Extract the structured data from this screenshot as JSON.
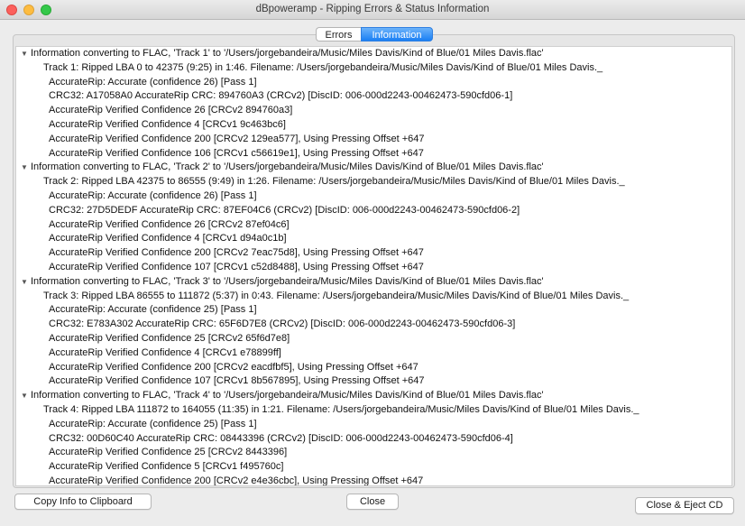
{
  "window": {
    "title": "dBpoweramp - Ripping Errors & Status Information"
  },
  "tabs": [
    {
      "label": "Errors",
      "selected": false
    },
    {
      "label": "Information",
      "selected": true
    }
  ],
  "log": [
    {
      "level": 0,
      "text": "Information converting to FLAC, 'Track 1' to '/Users/jorgebandeira/Music/Miles Davis/Kind of Blue/01 Miles Davis.flac'"
    },
    {
      "level": 1,
      "text": "Track 1:  Ripped LBA 0 to 42375 (9:25) in 1:46. Filename: /Users/jorgebandeira/Music/Miles Davis/Kind of Blue/01 Miles Davis._"
    },
    {
      "level": 2,
      "text": "AccurateRip: Accurate (confidence 26)     [Pass 1]"
    },
    {
      "level": 2,
      "text": "CRC32: A17058A0     AccurateRip CRC: 894760A3 (CRCv2)      [DiscID: 006-000d2243-00462473-590cfd06-1]"
    },
    {
      "level": 2,
      "text": "AccurateRip Verified Confidence 26 [CRCv2 894760a3]"
    },
    {
      "level": 2,
      "text": "AccurateRip Verified Confidence 4 [CRCv1 9c463bc6]"
    },
    {
      "level": 2,
      "text": "AccurateRip Verified Confidence 200 [CRCv2 129ea577], Using Pressing Offset +647"
    },
    {
      "level": 2,
      "text": "AccurateRip Verified Confidence 106 [CRCv1 c56619e1], Using Pressing Offset +647"
    },
    {
      "level": 0,
      "text": "Information converting to FLAC, 'Track 2' to '/Users/jorgebandeira/Music/Miles Davis/Kind of Blue/01 Miles Davis.flac'"
    },
    {
      "level": 1,
      "text": "Track 2:  Ripped LBA 42375 to 86555 (9:49) in 1:26. Filename: /Users/jorgebandeira/Music/Miles Davis/Kind of Blue/01 Miles Davis._"
    },
    {
      "level": 2,
      "text": "AccurateRip: Accurate (confidence 26)     [Pass 1]"
    },
    {
      "level": 2,
      "text": "CRC32: 27D5DEDF     AccurateRip CRC: 87EF04C6 (CRCv2)      [DiscID: 006-000d2243-00462473-590cfd06-2]"
    },
    {
      "level": 2,
      "text": "AccurateRip Verified Confidence 26 [CRCv2 87ef04c6]"
    },
    {
      "level": 2,
      "text": "AccurateRip Verified Confidence 4 [CRCv1 d94a0c1b]"
    },
    {
      "level": 2,
      "text": "AccurateRip Verified Confidence 200 [CRCv2 7eac75d8], Using Pressing Offset +647"
    },
    {
      "level": 2,
      "text": "AccurateRip Verified Confidence 107 [CRCv1 c52d8488], Using Pressing Offset +647"
    },
    {
      "level": 0,
      "text": "Information converting to FLAC, 'Track 3' to '/Users/jorgebandeira/Music/Miles Davis/Kind of Blue/01 Miles Davis.flac'"
    },
    {
      "level": 1,
      "text": "Track 3:  Ripped LBA 86555 to 111872 (5:37) in 0:43. Filename: /Users/jorgebandeira/Music/Miles Davis/Kind of Blue/01 Miles Davis._"
    },
    {
      "level": 2,
      "text": "AccurateRip: Accurate (confidence 25)     [Pass 1]"
    },
    {
      "level": 2,
      "text": "CRC32: E783A302     AccurateRip CRC: 65F6D7E8 (CRCv2)      [DiscID: 006-000d2243-00462473-590cfd06-3]"
    },
    {
      "level": 2,
      "text": "AccurateRip Verified Confidence 25 [CRCv2 65f6d7e8]"
    },
    {
      "level": 2,
      "text": "AccurateRip Verified Confidence 4 [CRCv1 e78899ff]"
    },
    {
      "level": 2,
      "text": "AccurateRip Verified Confidence 200 [CRCv2 eacdfbf5], Using Pressing Offset +647"
    },
    {
      "level": 2,
      "text": "AccurateRip Verified Confidence 107 [CRCv1 8b567895], Using Pressing Offset +647"
    },
    {
      "level": 0,
      "text": "Information converting to FLAC, 'Track 4' to '/Users/jorgebandeira/Music/Miles Davis/Kind of Blue/01 Miles Davis.flac'"
    },
    {
      "level": 1,
      "text": "Track 4:  Ripped LBA 111872 to 164055 (11:35) in 1:21. Filename: /Users/jorgebandeira/Music/Miles Davis/Kind of Blue/01 Miles Davis._"
    },
    {
      "level": 2,
      "text": "AccurateRip: Accurate (confidence 25)     [Pass 1]"
    },
    {
      "level": 2,
      "text": "CRC32: 00D60C40     AccurateRip CRC: 08443396 (CRCv2)      [DiscID: 006-000d2243-00462473-590cfd06-4]"
    },
    {
      "level": 2,
      "text": "AccurateRip Verified Confidence 25 [CRCv2 8443396]"
    },
    {
      "level": 2,
      "text": "AccurateRip Verified Confidence 5 [CRCv1 f495760c]"
    },
    {
      "level": 2,
      "text": "AccurateRip Verified Confidence 200 [CRCv2 e4e36cbc], Using Pressing Offset +647"
    }
  ],
  "buttons": {
    "copy": "Copy Info to Clipboard",
    "close": "Close",
    "close_eject": "Close & Eject CD"
  },
  "icons": {
    "disclosure": "disclosure-triangle-icon",
    "disclosure_glyph": "▼"
  },
  "colors": {
    "tab_selected": "#1a7ff4",
    "traffic_close": "#fc605c",
    "traffic_minimize": "#fdbc40",
    "traffic_maximize": "#34c84a"
  }
}
